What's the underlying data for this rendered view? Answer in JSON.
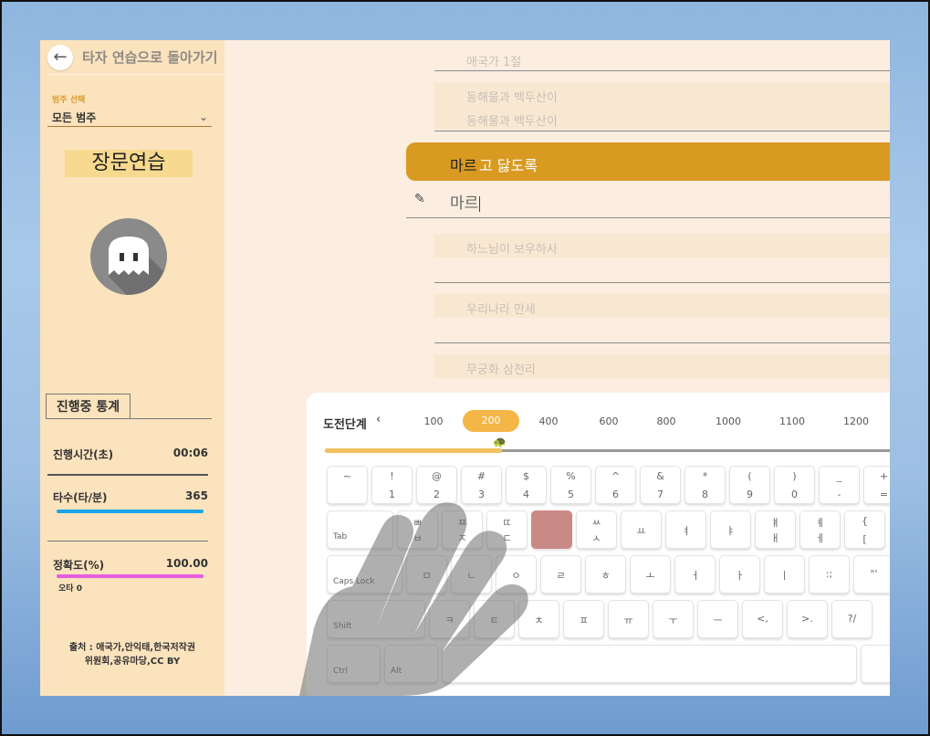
{
  "sidebar": {
    "back_label": "타자 연습으로 돌아가기",
    "category_label": "범주 선택",
    "category_value": "모든 범주",
    "mode_title": "장문연습",
    "stats_tab": "진행중 통계",
    "elapsed_label": "진행시간(초)",
    "elapsed_value": "00:06",
    "speed_label": "타수(타/분)",
    "speed_value": "365",
    "accuracy_label": "정확도(%)",
    "accuracy_value": "100.00",
    "typo_label": "오타 0",
    "credit_line1": "출처 : 애국가,안익태,한국저작권",
    "credit_line2": "위원회,공유마당,CC BY",
    "colors": {
      "speed_bar": "#1aa3e8",
      "accuracy_bar": "#e75ce0"
    }
  },
  "lyrics": {
    "title": "애국가 1절",
    "prev_line": "동해물과 백두산이",
    "prev_typed": "동해물과 백두산이",
    "current_typed_part": "마르",
    "current_rest": "고 닳도록",
    "input_value": "마르",
    "next_lines": [
      "하느님이 보우하사",
      "우리나라 만세",
      "무궁화 삼천리"
    ]
  },
  "levels": {
    "title": "도전단계",
    "items": [
      "100",
      "200",
      "400",
      "600",
      "800",
      "1000",
      "1100",
      "1200"
    ],
    "active": "200",
    "progress_fraction": 0.3
  },
  "keyboard": {
    "row1": [
      {
        "t": "~",
        "b": ""
      },
      {
        "t": "!",
        "b": "1"
      },
      {
        "t": "@",
        "b": "2"
      },
      {
        "t": "#",
        "b": "3"
      },
      {
        "t": "$",
        "b": "4"
      },
      {
        "t": "%",
        "b": "5"
      },
      {
        "t": "^",
        "b": "6"
      },
      {
        "t": "&",
        "b": "7"
      },
      {
        "t": "*",
        "b": "8"
      },
      {
        "t": "(",
        "b": "9"
      },
      {
        "t": ")",
        "b": "0"
      },
      {
        "t": "_",
        "b": "-"
      },
      {
        "t": "+",
        "b": "="
      }
    ],
    "row2": [
      {
        "t": "ㅃ",
        "b": "ㅂ"
      },
      {
        "t": "ㅉ",
        "b": "ㅈ"
      },
      {
        "t": "ㄸ",
        "b": "ㄷ"
      },
      {
        "t": "",
        "b": ""
      },
      {
        "t": "ㅆ",
        "b": "ㅅ"
      },
      {
        "t": "",
        "b": "ㅛ"
      },
      {
        "t": "",
        "b": "ㅕ"
      },
      {
        "t": "",
        "b": "ㅑ"
      },
      {
        "t": "ㅒ",
        "b": "ㅐ"
      },
      {
        "t": "ㅖ",
        "b": "ㅔ"
      },
      {
        "t": "{",
        "b": "["
      }
    ],
    "row3": [
      "ㅁ",
      "ㄴ",
      "ㅇ",
      "ㄹ",
      "ㅎ",
      "ㅗ",
      "ㅓ",
      "ㅏ",
      "ㅣ",
      ":;",
      "\"'"
    ],
    "row4": [
      "ㅋ",
      "ㅌ",
      "ㅊ",
      "ㅍ",
      "ㅠ",
      "ㅜ",
      "ㅡ",
      "<,",
      ">.",
      "?/"
    ],
    "tab": "Tab",
    "caps": "Caps Lock",
    "shift": "Shift",
    "ctrl": "Ctrl",
    "alt": "Alt",
    "highlight_color": "#c98a86"
  }
}
